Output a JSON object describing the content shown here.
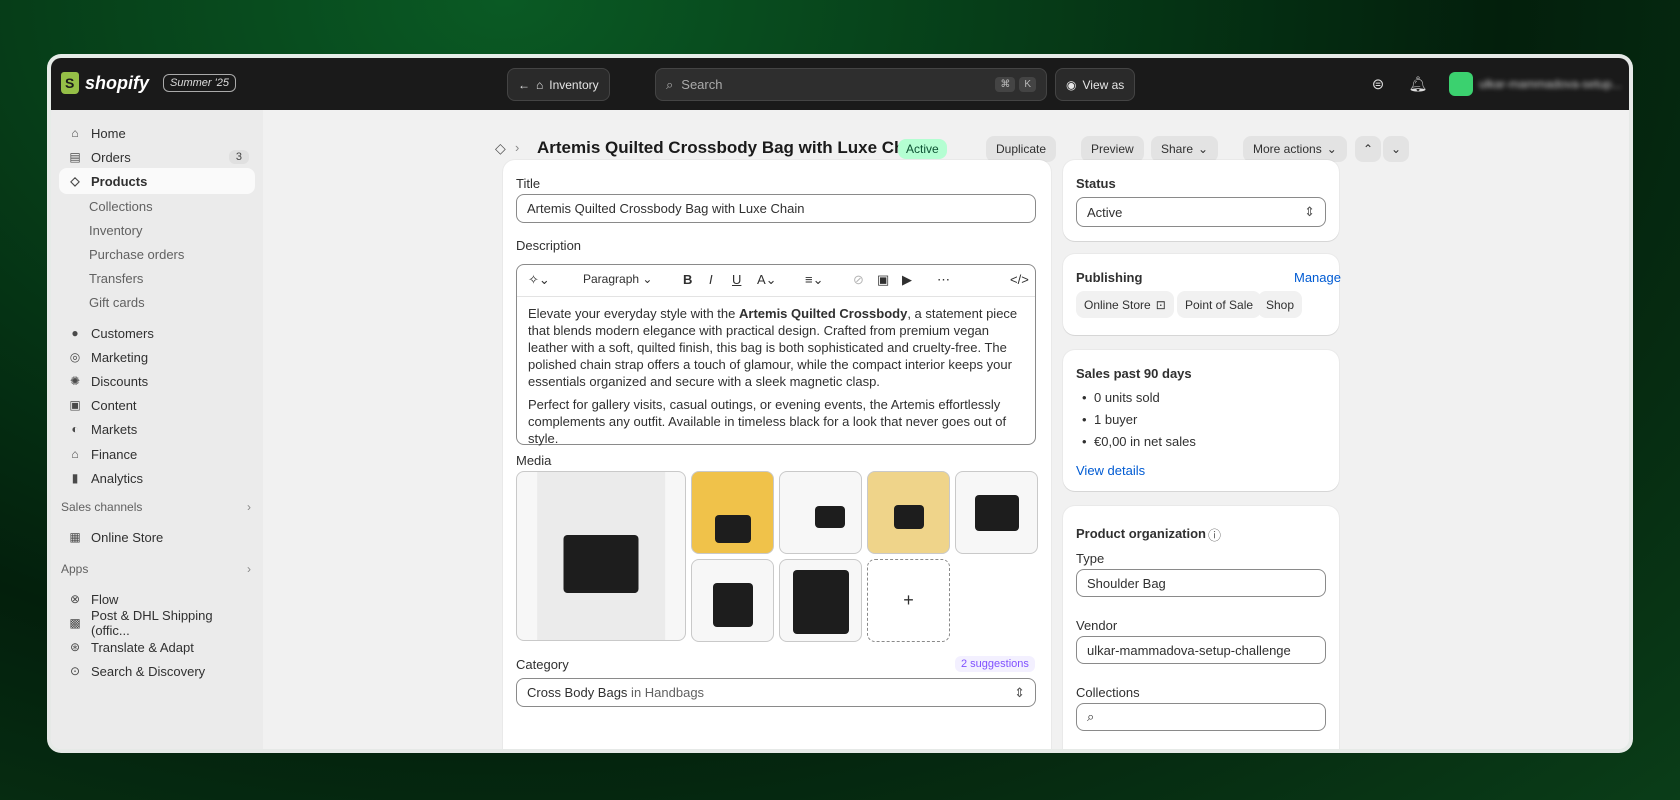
{
  "app": {
    "logo_text": "shopify",
    "edition": "Summer '25"
  },
  "topbar": {
    "back_label": "Inventory",
    "search_placeholder": "Search",
    "search_kbd": [
      "⌘",
      "K"
    ],
    "view_as_label": "View as",
    "account_name": "ulkar-mammadova-setup..."
  },
  "sidebar": {
    "items": [
      {
        "label": "Home",
        "icon": "home-icon"
      },
      {
        "label": "Orders",
        "icon": "inbox-icon",
        "badge": "3"
      },
      {
        "label": "Products",
        "icon": "tag-icon",
        "selected": true
      },
      {
        "label": "Collections",
        "sub": true
      },
      {
        "label": "Inventory",
        "sub": true
      },
      {
        "label": "Purchase orders",
        "sub": true
      },
      {
        "label": "Transfers",
        "sub": true
      },
      {
        "label": "Gift cards",
        "sub": true
      },
      {
        "label": "Customers",
        "icon": "person-icon"
      },
      {
        "label": "Marketing",
        "icon": "target-icon"
      },
      {
        "label": "Discounts",
        "icon": "discount-icon"
      },
      {
        "label": "Content",
        "icon": "content-icon"
      },
      {
        "label": "Markets",
        "icon": "globe-icon"
      },
      {
        "label": "Finance",
        "icon": "bank-icon"
      },
      {
        "label": "Analytics",
        "icon": "chart-icon"
      }
    ],
    "sales_channels_label": "Sales channels",
    "channels": [
      {
        "label": "Online Store",
        "icon": "store-icon"
      }
    ],
    "apps_label": "Apps",
    "apps": [
      {
        "label": "Flow",
        "icon": "flow-icon"
      },
      {
        "label": "Post & DHL Shipping (offic...",
        "icon": "shipping-icon"
      },
      {
        "label": "Translate & Adapt",
        "icon": "translate-icon"
      },
      {
        "label": "Search & Discovery",
        "icon": "search-discovery-icon"
      }
    ]
  },
  "header": {
    "title": "Artemis Quilted Crossbody Bag with Luxe Chain",
    "status": "Active",
    "buttons": {
      "duplicate": "Duplicate",
      "preview": "Preview",
      "share": "Share",
      "more": "More actions"
    }
  },
  "product": {
    "title_label": "Title",
    "title_value": "Artemis Quilted Crossbody Bag with Luxe Chain",
    "description_label": "Description",
    "paragraph_select": "Paragraph",
    "desc_p1_pre": "Elevate your everyday style with the ",
    "desc_p1_bold": "Artemis Quilted Crossbody",
    "desc_p1_post": ", a statement piece that blends modern elegance with practical design. Crafted from premium vegan leather with a soft, quilted finish, this bag is both sophisticated and cruelty-free. The polished chain strap offers a touch of glamour, while the compact interior keeps your essentials organized and secure with a sleek magnetic clasp.",
    "desc_p2": "Perfect for gallery visits, casual outings, or evening events, the Artemis effortlessly complements any outfit. Available in timeless black for a look that never goes out of style.",
    "media_label": "Media",
    "add_media": "+",
    "category_label": "Category",
    "suggestions": "2 suggestions",
    "category_value": "Cross Body Bags",
    "category_in": " in Handbags"
  },
  "status_card": {
    "label": "Status",
    "value": "Active"
  },
  "publishing": {
    "label": "Publishing",
    "manage": "Manage",
    "channels": [
      "Online Store",
      "Point of Sale",
      "Shop"
    ]
  },
  "sales": {
    "label": "Sales past 90 days",
    "items": [
      "0 units sold",
      "1 buyer",
      "€0,00 in net sales"
    ],
    "view_details": "View details"
  },
  "organization": {
    "label": "Product organization",
    "type_label": "Type",
    "type_value": "Shoulder Bag",
    "vendor_label": "Vendor",
    "vendor_value": "ulkar-mammadova-setup-challenge",
    "collections_label": "Collections"
  },
  "colors": {
    "accent": "#005bd3",
    "active_bg": "#b4fed2",
    "suggestion": "#8051ff"
  }
}
